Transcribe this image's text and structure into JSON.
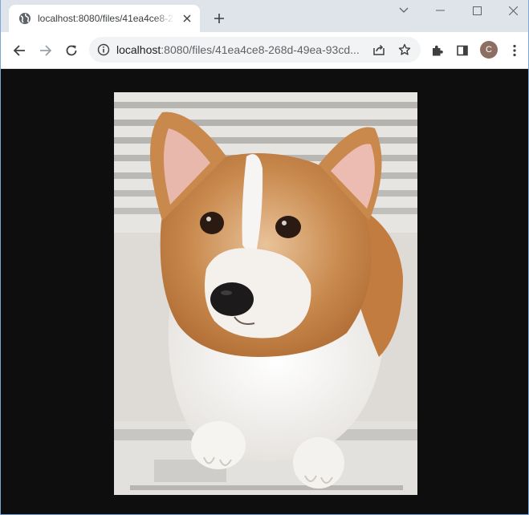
{
  "tab": {
    "title": "localhost:8080/files/41ea4ce8-268d-49ea-93cd"
  },
  "address_bar": {
    "host": "localhost",
    "rest": ":8080/files/41ea4ce8-268d-49ea-93cd..."
  },
  "profile": {
    "initial": "C",
    "color": "#8d6e63"
  },
  "icons": {
    "favicon": "globe-icon",
    "tab_close": "close-icon",
    "new_tab": "plus-icon",
    "back": "arrow-left-icon",
    "forward": "arrow-right-icon",
    "reload": "reload-icon",
    "site_info": "info-icon",
    "share": "share-icon",
    "bookmark": "star-icon",
    "extensions": "puzzle-icon",
    "side_panel": "side-panel-icon",
    "menu": "kebab-menu-icon",
    "minimize": "minimize-icon",
    "maximize": "maximize-icon",
    "close_window": "close-window-icon",
    "tab_search": "chevron-down-icon"
  },
  "viewer": {
    "background": "#0e0e0e",
    "image_subject": "corgi-photo"
  }
}
